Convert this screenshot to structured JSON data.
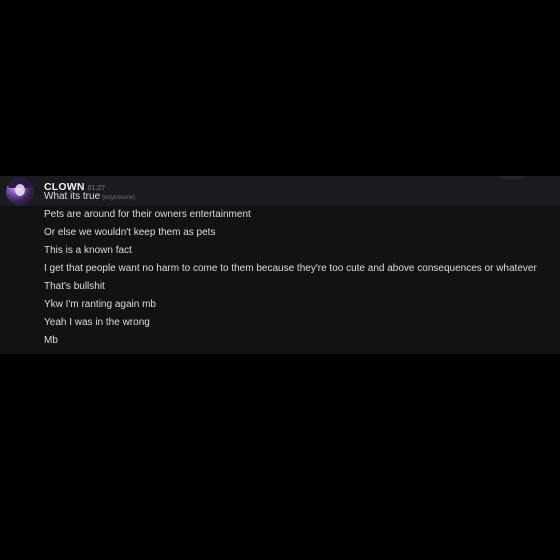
{
  "message_group": {
    "author": {
      "username": "CLOWN",
      "timestamp": "01:27",
      "avatar": "anime-character-avatar"
    },
    "first_message": {
      "text": "What its true",
      "tag": "(edytowane)"
    },
    "messages": [
      "Pets are around for their owners entertainment",
      "Or else we wouldn't keep them as pets",
      "This is a known fact",
      "I get that people want no harm to come to them because they're too cute and above consequences or whatever",
      "That's bullshit",
      "Ykw I'm ranting again mb",
      "Yeah I was in the wrong",
      "Mb"
    ]
  },
  "colors": {
    "page_background": "#000000",
    "chat_background": "#111214",
    "hover_row": "#1a1b1f",
    "username": "#f2f3f5",
    "message_text": "#dbdee1",
    "timestamp": "#80848e"
  }
}
